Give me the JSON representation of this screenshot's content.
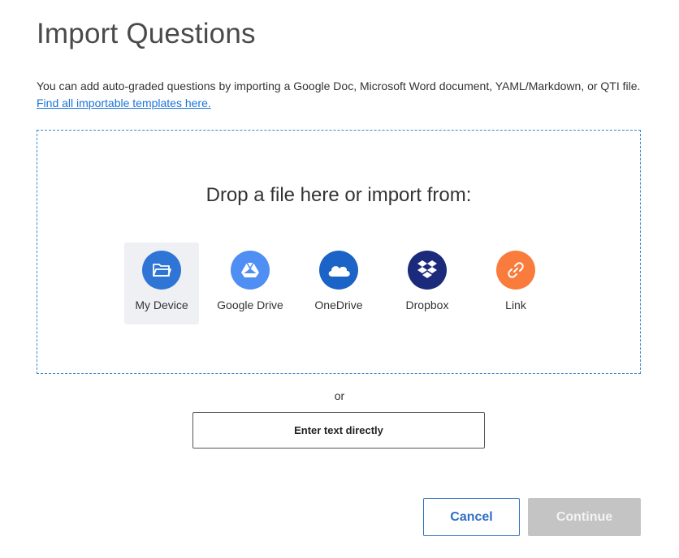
{
  "dialog": {
    "title": "Import Questions",
    "description": "You can add auto-graded questions by importing a Google Doc, Microsoft Word document, YAML/Markdown, or QTI file.",
    "templates_link": "Find all importable templates here."
  },
  "dropzone": {
    "heading": "Drop a file here or import from:",
    "sources": [
      {
        "label": "My Device",
        "icon": "folder-icon",
        "color": "#2f75d6",
        "selected": true
      },
      {
        "label": "Google Drive",
        "icon": "google-drive-icon",
        "color": "#4f8ef2"
      },
      {
        "label": "OneDrive",
        "icon": "onedrive-cloud-icon",
        "color": "#1b63c6"
      },
      {
        "label": "Dropbox",
        "icon": "dropbox-icon",
        "color": "#1b2a7a"
      },
      {
        "label": "Link",
        "icon": "link-icon",
        "color": "#f97c3c"
      }
    ]
  },
  "separator": "or",
  "enter_text_label": "Enter text directly",
  "footer": {
    "cancel_label": "Cancel",
    "continue_label": "Continue"
  }
}
